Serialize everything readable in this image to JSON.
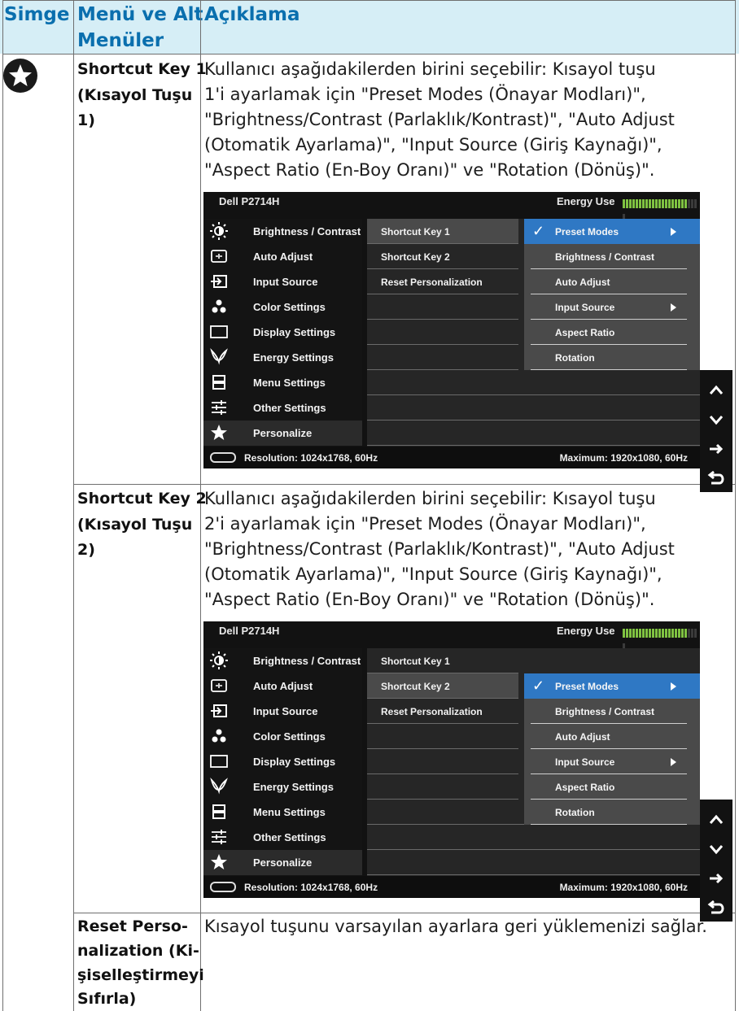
{
  "header": {
    "col1": "Simge",
    "col2_line1": "Menü ve Alt",
    "col2_line2": "Menüler",
    "col3": "Açıklama"
  },
  "rows": [
    {
      "menu_lines": [
        "Shortcut Key 1",
        "(Kısayol Tuşu",
        "1)"
      ],
      "desc_lines": [
        "Kullanıcı aşağıdakilerden birini seçebilir: Kısayol tuşu",
        "1'i ayarlamak için \"Preset Modes (Önayar Modları)\",",
        "\"Brightness/Contrast (Parlaklık/Kontrast)\", \"Auto Adjust",
        "(Otomatik Ayarlama)\", \"Input Source (Giriş Kaynağı)\",",
        "\"Aspect Ratio (En-Boy Oranı)\" ve \"Rotation (Dönüş)\"."
      ]
    },
    {
      "menu_lines": [
        "Shortcut Key 2",
        "(Kısayol Tuşu",
        "2)"
      ],
      "desc_lines": [
        "Kullanıcı aşağıdakilerden birini seçebilir: Kısayol tuşu",
        "2'i ayarlamak için \"Preset Modes (Önayar Modları)\",",
        "\"Brightness/Contrast (Parlaklık/Kontrast)\", \"Auto Adjust",
        "(Otomatik Ayarlama)\", \"Input Source (Giriş Kaynağı)\",",
        "\"Aspect Ratio (En-Boy Oranı)\" ve \"Rotation (Dönüş)\"."
      ]
    },
    {
      "menu_lines": [
        "Reset Perso-",
        "nalization (Ki-",
        "şiselleştirmeyi",
        "Sıfırla)"
      ],
      "desc_lines": [
        "Kısayol tuşunu varsayılan ayarlara geri yüklemenizi sağlar."
      ]
    }
  ],
  "osd": {
    "title": "Dell P2714H",
    "energy_label": "Energy Use",
    "energy_level": 0.82,
    "left_menu": [
      {
        "label": "Brightness / Contrast",
        "icon": "sun-icon"
      },
      {
        "label": "Auto Adjust",
        "icon": "auto-adjust-icon"
      },
      {
        "label": "Input Source",
        "icon": "input-source-icon"
      },
      {
        "label": "Color Settings",
        "icon": "color-dots-icon"
      },
      {
        "label": "Display Settings",
        "icon": "display-icon"
      },
      {
        "label": "Energy Settings",
        "icon": "leaf-icon"
      },
      {
        "label": "Menu Settings",
        "icon": "menu-icon"
      },
      {
        "label": "Other Settings",
        "icon": "sliders-icon"
      },
      {
        "label": "Personalize",
        "icon": "star-icon"
      }
    ],
    "mid_menu": [
      "Shortcut Key 1",
      "Shortcut Key 2",
      "Reset Personalization"
    ],
    "sub_menu": [
      "Preset Modes",
      "Brightness / Contrast",
      "Auto Adjust",
      "Input Source",
      "Aspect Ratio",
      "Rotation"
    ],
    "footer_left": "Resolution: 1024x1768, 60Hz",
    "footer_right": "Maximum: 1920x1080, 60Hz",
    "nav_buttons": [
      "up-arrow-icon",
      "down-arrow-icon",
      "right-arrow-icon",
      "back-icon"
    ]
  },
  "colors": {
    "header_bg": "#d6eef6",
    "header_text": "#0a6fae",
    "osd_highlight": "#2f78c4",
    "energy_bar": "#7fc241"
  }
}
